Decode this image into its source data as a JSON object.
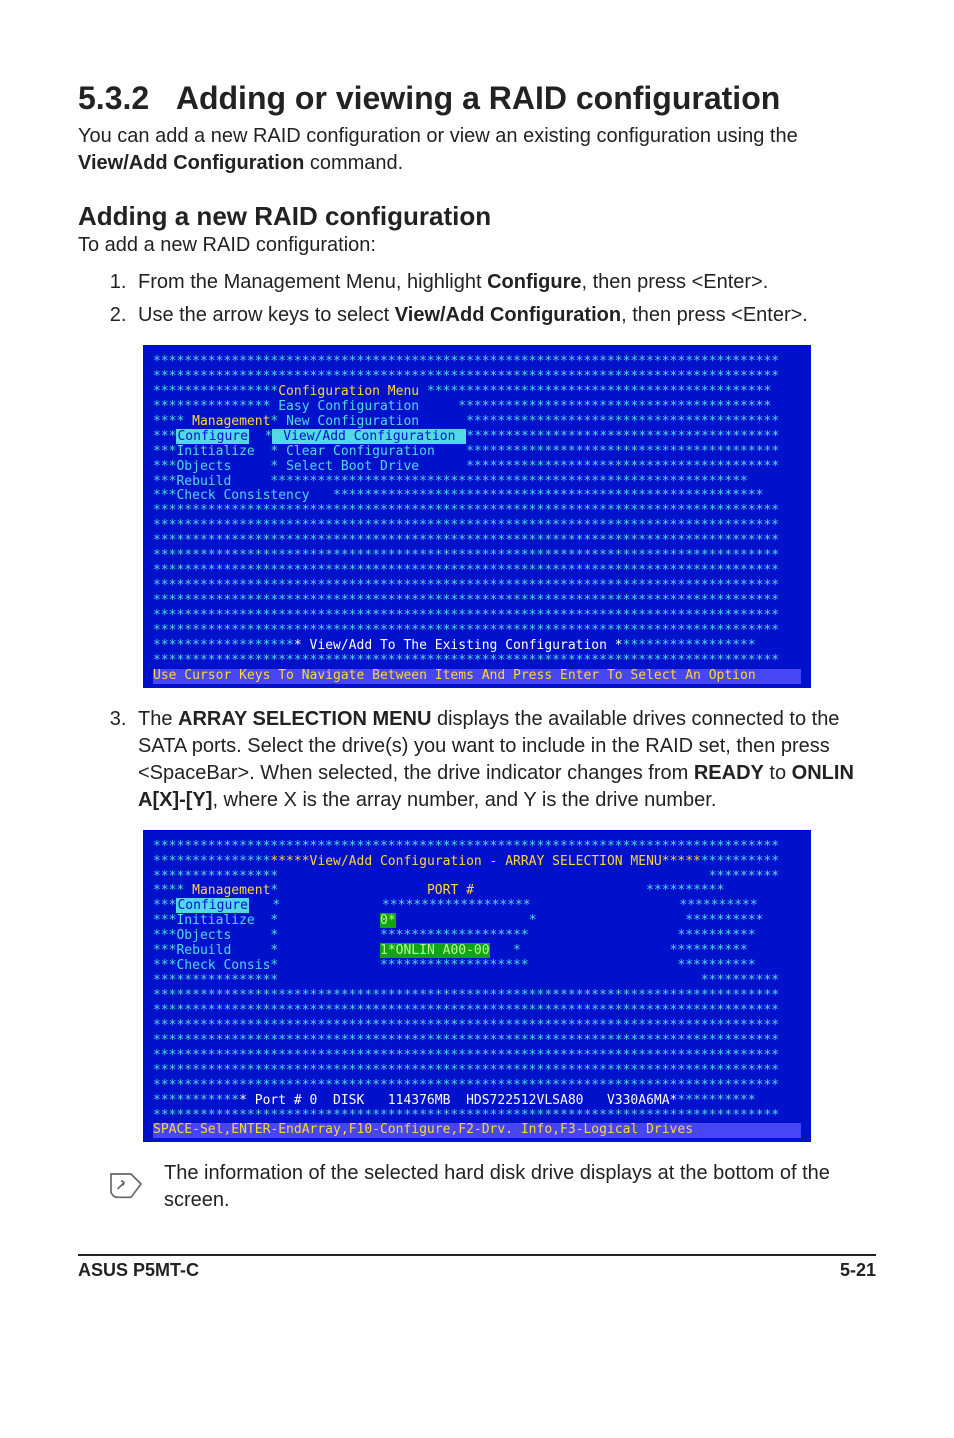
{
  "section": {
    "number": "5.3.2",
    "title": "Adding or viewing a RAID configuration",
    "intro_1": "You can add a new RAID configuration or view an existing configuration using the ",
    "intro_cmd": "View/Add Configuration",
    "intro_2": " command."
  },
  "subsection": {
    "title": "Adding a new RAID configuration",
    "intro": "To add a new RAID configuration:"
  },
  "steps_a": [
    {
      "pre": "From the Management Menu, highlight ",
      "bold": "Configure",
      "post": ", then press <Enter>."
    },
    {
      "pre": "Use the arrow keys to select ",
      "bold": "View/Add Configuration",
      "post": ", then press <Enter>."
    }
  ],
  "terminal1": {
    "menu_title": "Configuration Menu",
    "items": [
      "Easy Configuration",
      "New Configuration",
      "View/Add Configuration",
      "Clear Configuration",
      "Select Boot Drive"
    ],
    "sidebar": [
      "Management",
      "Configure",
      "Initialize",
      "Objects",
      "Rebuild",
      "Check Consistency"
    ],
    "prompt_line": "* View/Add To The Existing Configuration *",
    "help_line": "Use Cursor Keys To Navigate Between Items And Press Enter To Select An Option"
  },
  "step_3": {
    "t1": "The ",
    "b1": "ARRAY SELECTION MENU",
    "t2": " displays the available drives connected to the SATA ports. Select the drive(s) you want to include in the RAID set, then press <SpaceBar>. When selected, the drive indicator changes from ",
    "b2": "READY",
    "t3": " to ",
    "b3": "ONLIN A[X]-[Y]",
    "t4": ", where X is the array number, and Y is the drive number."
  },
  "terminal2": {
    "header": "*****View/Add Configuration - ARRAY SELECTION MENU*****",
    "sidebar": [
      "Management",
      "Configure",
      "Initialize",
      "Objects",
      "Rebuild",
      "Check Consis"
    ],
    "port_header": "PORT #",
    "rows": [
      "0*",
      "1*ONLIN A00-00"
    ],
    "footer_drive": "* Port # 0  DISK   114376MB  HDS722512VLSA80   V330A6MA*",
    "help_line": "SPACE-Sel,ENTER-EndArray,F10-Configure,F2-Drv. Info,F3-Logical Drives"
  },
  "note": {
    "text": "The information of the selected hard disk drive displays at the bottom of the screen."
  },
  "footer": {
    "left": "ASUS P5MT-C",
    "right": "5-21"
  }
}
